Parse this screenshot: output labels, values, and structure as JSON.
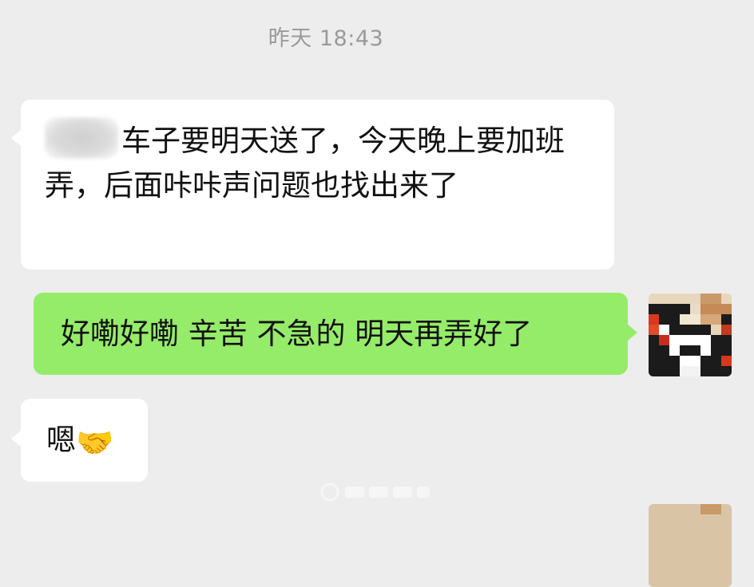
{
  "chat": {
    "timestamp": "昨天 18:43",
    "messages": [
      {
        "direction": "incoming",
        "redacted_prefix": true,
        "text": "车子要明天送了，今天晚上要加班弄，后面咔咔声问题也找出来了"
      },
      {
        "direction": "outgoing",
        "text": "好嘞好嘞 辛苦 不急的 明天再弄好了"
      },
      {
        "direction": "incoming",
        "text": "嗯",
        "emoji": "🤝"
      }
    ]
  },
  "icons": {
    "avatar": "pixel-art-avatar-icon",
    "emoji": "handshake-icon",
    "watermark": "weibo-watermark-icon"
  },
  "colors": {
    "background": "#ededed",
    "incoming_bubble": "#ffffff",
    "outgoing_bubble": "#95ec69",
    "timestamp_text": "#9a9a9a",
    "message_text": "#111111"
  }
}
